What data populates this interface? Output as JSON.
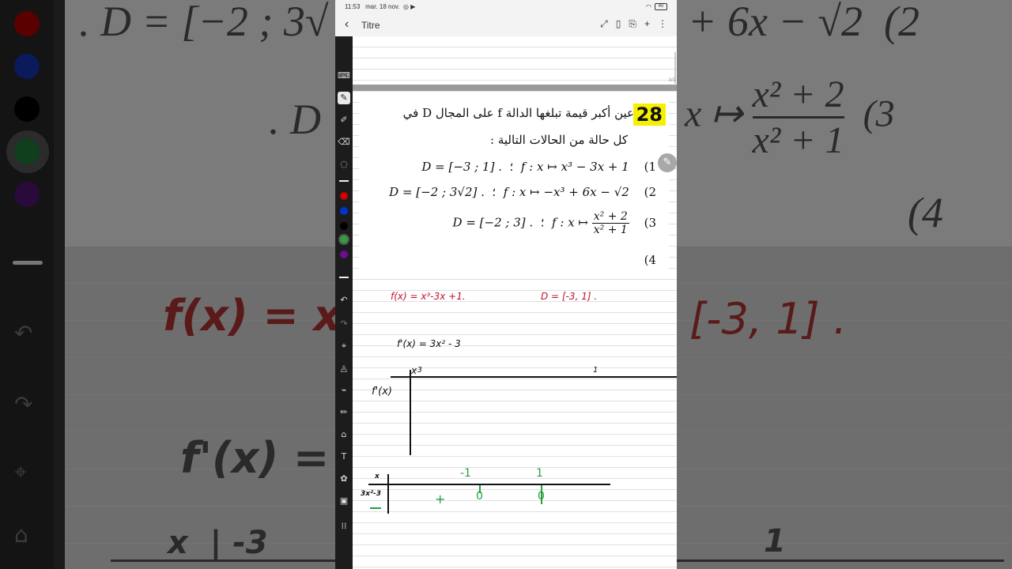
{
  "status_bar": {
    "time": "11:53",
    "date": "mar. 18 nov.",
    "battery": "40"
  },
  "document": {
    "title": "Titre"
  },
  "toolbar": {
    "back_icon": "chevron-left-icon",
    "expand_icon": "expand-icon",
    "reader_icon": "book-icon",
    "export_icon": "export-icon",
    "add_icon": "plus-icon",
    "more_icon": "more-vertical-icon"
  },
  "pen_colors": [
    "#cc0000",
    "#0033cc",
    "#000000",
    "#2e9e3e",
    "#6a0f8e"
  ],
  "page_indicator": "3/3",
  "problem": {
    "number": "28",
    "line1": "عين أكبر قيمة تبلغها الدالة f على المجال D في",
    "line2": "كل حالة من الحالات التالية :",
    "case1": {
      "num": "(1",
      "sep": "؛",
      "func": "f : x ↦ x³ − 3x + 1",
      "domain": "D = [−3 ; 1] ."
    },
    "case2": {
      "num": "(2",
      "sep": "؛",
      "func": "f : x ↦ −x³ + 6x − √2",
      "domain": "D = [−2 ; 3√2] ."
    },
    "case3": {
      "num": "(3",
      "sep": "؛",
      "func_prefix": "f : x ↦",
      "frac_num": "x² + 2",
      "frac_den": "x² + 1",
      "domain": "D = [−2 ; 3] ."
    },
    "case4": {
      "num": "(4"
    }
  },
  "handwriting": {
    "fx": "f(x) = x³-3x +1.",
    "domain": "D = [-3, 1] .",
    "derivative": "f'(x) = 3x² - 3",
    "table1": {
      "x_label": "x",
      "start": "-3",
      "end": "1",
      "row_label": "f'(x)"
    },
    "table2": {
      "top_label": "x",
      "row_label": "3x²-3",
      "root1": "-1",
      "root2": "1",
      "sign1": "+",
      "zero1": "0",
      "zero2": "0"
    }
  }
}
